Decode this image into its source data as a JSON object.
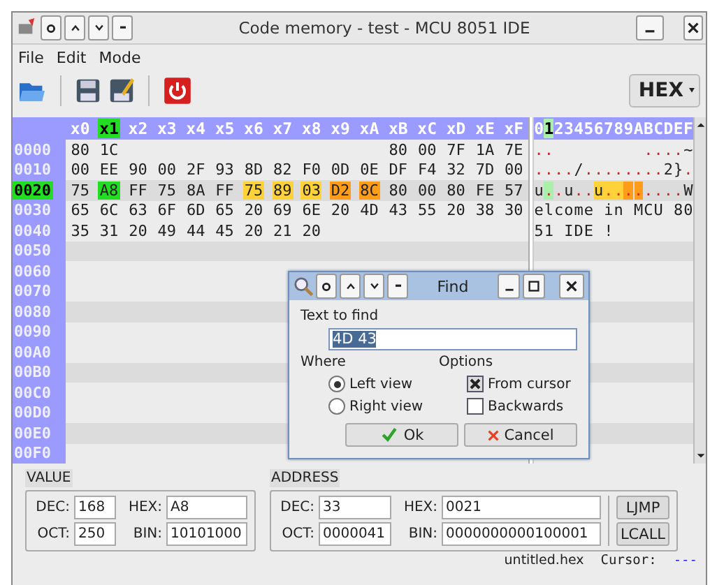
{
  "window": {
    "title": "Code memory - test - MCU 8051 IDE"
  },
  "menu": [
    {
      "label": "File"
    },
    {
      "label": "Edit"
    },
    {
      "label": "Mode"
    }
  ],
  "toolbar": {
    "mode": "HEX"
  },
  "hex": {
    "columns": [
      {
        "label": "x0",
        "selected": false
      },
      {
        "label": "x1",
        "selected": true
      },
      {
        "label": "x2",
        "selected": false
      },
      {
        "label": "x3",
        "selected": false
      },
      {
        "label": "x4",
        "selected": false
      },
      {
        "label": "x5",
        "selected": false
      },
      {
        "label": "x6",
        "selected": false
      },
      {
        "label": "x7",
        "selected": false
      },
      {
        "label": "x8",
        "selected": false
      },
      {
        "label": "x9",
        "selected": false
      },
      {
        "label": "xA",
        "selected": false
      },
      {
        "label": "xB",
        "selected": false
      },
      {
        "label": "xC",
        "selected": false
      },
      {
        "label": "xD",
        "selected": false
      },
      {
        "label": "xE",
        "selected": false
      },
      {
        "label": "xF",
        "selected": false
      }
    ],
    "ascii_columns": [
      {
        "label": "0",
        "selected": false
      },
      {
        "label": "1",
        "selected": true
      },
      {
        "label": "2",
        "selected": false
      },
      {
        "label": "3",
        "selected": false
      },
      {
        "label": "4",
        "selected": false
      },
      {
        "label": "5",
        "selected": false
      },
      {
        "label": "6",
        "selected": false
      },
      {
        "label": "7",
        "selected": false
      },
      {
        "label": "8",
        "selected": false
      },
      {
        "label": "9",
        "selected": false
      },
      {
        "label": "A",
        "selected": false
      },
      {
        "label": "B",
        "selected": false
      },
      {
        "label": "C",
        "selected": false
      },
      {
        "label": "D",
        "selected": false
      },
      {
        "label": "E",
        "selected": false
      },
      {
        "label": "F",
        "selected": false
      }
    ],
    "rows": [
      {
        "address": "0000",
        "selected": false,
        "cells": [
          {
            "kind": "byte",
            "text": "80"
          },
          {
            "kind": "byte",
            "text": "1C"
          },
          {
            "kind": "empty"
          },
          {
            "kind": "empty"
          },
          {
            "kind": "empty"
          },
          {
            "kind": "empty"
          },
          {
            "kind": "empty"
          },
          {
            "kind": "empty"
          },
          {
            "kind": "empty"
          },
          {
            "kind": "empty"
          },
          {
            "kind": "empty"
          },
          {
            "kind": "byte",
            "text": "80"
          },
          {
            "kind": "byte",
            "text": "00"
          },
          {
            "kind": "byte",
            "text": "7F"
          },
          {
            "kind": "byte",
            "text": "1A"
          },
          {
            "kind": "byte",
            "text": "7E"
          }
        ],
        "ascii": [
          {
            "kind": "char",
            "char": ".",
            "unprintable": true
          },
          {
            "kind": "char",
            "char": ".",
            "unprintable": true
          },
          {
            "kind": "empty"
          },
          {
            "kind": "empty"
          },
          {
            "kind": "empty"
          },
          {
            "kind": "empty"
          },
          {
            "kind": "empty"
          },
          {
            "kind": "empty"
          },
          {
            "kind": "empty"
          },
          {
            "kind": "empty"
          },
          {
            "kind": "empty"
          },
          {
            "kind": "char",
            "char": ".",
            "unprintable": true
          },
          {
            "kind": "char",
            "char": ".",
            "unprintable": true
          },
          {
            "kind": "char",
            "char": ".",
            "unprintable": true
          },
          {
            "kind": "char",
            "char": ".",
            "unprintable": true
          },
          {
            "kind": "char",
            "char": "~",
            "unprintable": false
          }
        ]
      },
      {
        "address": "0010",
        "selected": false,
        "cells": [
          {
            "kind": "byte",
            "text": "00"
          },
          {
            "kind": "byte",
            "text": "EE"
          },
          {
            "kind": "byte",
            "text": "90"
          },
          {
            "kind": "byte",
            "text": "00"
          },
          {
            "kind": "byte",
            "text": "2F"
          },
          {
            "kind": "byte",
            "text": "93"
          },
          {
            "kind": "byte",
            "text": "8D"
          },
          {
            "kind": "byte",
            "text": "82"
          },
          {
            "kind": "byte",
            "text": "F0"
          },
          {
            "kind": "byte",
            "text": "0D"
          },
          {
            "kind": "byte",
            "text": "0E"
          },
          {
            "kind": "byte",
            "text": "DF"
          },
          {
            "kind": "byte",
            "text": "F4"
          },
          {
            "kind": "byte",
            "text": "32"
          },
          {
            "kind": "byte",
            "text": "7D"
          },
          {
            "kind": "byte",
            "text": "00"
          }
        ],
        "ascii": [
          {
            "kind": "char",
            "char": ".",
            "unprintable": true
          },
          {
            "kind": "char",
            "char": ".",
            "unprintable": true
          },
          {
            "kind": "char",
            "char": ".",
            "unprintable": true
          },
          {
            "kind": "char",
            "char": ".",
            "unprintable": true
          },
          {
            "kind": "char",
            "char": "/",
            "unprintable": false
          },
          {
            "kind": "char",
            "char": ".",
            "unprintable": true
          },
          {
            "kind": "char",
            "char": ".",
            "unprintable": true
          },
          {
            "kind": "char",
            "char": ".",
            "unprintable": true
          },
          {
            "kind": "char",
            "char": ".",
            "unprintable": true
          },
          {
            "kind": "char",
            "char": ".",
            "unprintable": true
          },
          {
            "kind": "char",
            "char": ".",
            "unprintable": true
          },
          {
            "kind": "char",
            "char": ".",
            "unprintable": true
          },
          {
            "kind": "char",
            "char": ".",
            "unprintable": true
          },
          {
            "kind": "char",
            "char": "2",
            "unprintable": false
          },
          {
            "kind": "char",
            "char": "}",
            "unprintable": false
          },
          {
            "kind": "char",
            "char": ".",
            "unprintable": true
          }
        ]
      },
      {
        "address": "0020",
        "selected": true,
        "cells": [
          {
            "kind": "byte",
            "text": "75"
          },
          {
            "kind": "byte",
            "text": "A8",
            "color": "#22dd22"
          },
          {
            "kind": "byte",
            "text": "FF"
          },
          {
            "kind": "byte",
            "text": "75"
          },
          {
            "kind": "byte",
            "text": "8A"
          },
          {
            "kind": "byte",
            "text": "FF"
          },
          {
            "kind": "byte",
            "text": "75",
            "color": "#ffd23a"
          },
          {
            "kind": "byte",
            "text": "89",
            "color": "#ffd23a"
          },
          {
            "kind": "byte",
            "text": "03",
            "color": "#ffd23a"
          },
          {
            "kind": "byte",
            "text": "D2",
            "color": "#ff9c1a"
          },
          {
            "kind": "byte",
            "text": "8C",
            "color": "#ff9c1a"
          },
          {
            "kind": "byte",
            "text": "80"
          },
          {
            "kind": "byte",
            "text": "00"
          },
          {
            "kind": "byte",
            "text": "80"
          },
          {
            "kind": "byte",
            "text": "FE"
          },
          {
            "kind": "byte",
            "text": "57"
          }
        ],
        "ascii": [
          {
            "kind": "char",
            "char": "u",
            "unprintable": false
          },
          {
            "kind": "char",
            "char": ".",
            "unprintable": true,
            "color": "#aaf0aa"
          },
          {
            "kind": "char",
            "char": ".",
            "unprintable": true
          },
          {
            "kind": "char",
            "char": "u",
            "unprintable": false
          },
          {
            "kind": "char",
            "char": ".",
            "unprintable": true
          },
          {
            "kind": "char",
            "char": ".",
            "unprintable": true
          },
          {
            "kind": "char",
            "char": "u",
            "unprintable": false,
            "color": "#ffd23a"
          },
          {
            "kind": "char",
            "char": ".",
            "unprintable": true,
            "color": "#ffd23a"
          },
          {
            "kind": "char",
            "char": ".",
            "unprintable": true,
            "color": "#ffd23a"
          },
          {
            "kind": "char",
            "char": ".",
            "unprintable": true,
            "color": "#ff9c1a"
          },
          {
            "kind": "char",
            "char": ".",
            "unprintable": true,
            "color": "#ff9c1a"
          },
          {
            "kind": "char",
            "char": ".",
            "unprintable": true
          },
          {
            "kind": "char",
            "char": ".",
            "unprintable": true
          },
          {
            "kind": "char",
            "char": ".",
            "unprintable": true
          },
          {
            "kind": "char",
            "char": ".",
            "unprintable": true
          },
          {
            "kind": "char",
            "char": "W",
            "unprintable": false
          }
        ]
      },
      {
        "address": "0030",
        "selected": false,
        "cells": [
          {
            "kind": "byte",
            "text": "65"
          },
          {
            "kind": "byte",
            "text": "6C"
          },
          {
            "kind": "byte",
            "text": "63"
          },
          {
            "kind": "byte",
            "text": "6F"
          },
          {
            "kind": "byte",
            "text": "6D"
          },
          {
            "kind": "byte",
            "text": "65"
          },
          {
            "kind": "byte",
            "text": "20"
          },
          {
            "kind": "byte",
            "text": "69"
          },
          {
            "kind": "byte",
            "text": "6E"
          },
          {
            "kind": "byte",
            "text": "20"
          },
          {
            "kind": "byte",
            "text": "4D"
          },
          {
            "kind": "byte",
            "text": "43"
          },
          {
            "kind": "byte",
            "text": "55"
          },
          {
            "kind": "byte",
            "text": "20"
          },
          {
            "kind": "byte",
            "text": "38"
          },
          {
            "kind": "byte",
            "text": "30"
          }
        ],
        "ascii": [
          {
            "kind": "char",
            "char": "e",
            "unprintable": false
          },
          {
            "kind": "char",
            "char": "l",
            "unprintable": false
          },
          {
            "kind": "char",
            "char": "c",
            "unprintable": false
          },
          {
            "kind": "char",
            "char": "o",
            "unprintable": false
          },
          {
            "kind": "char",
            "char": "m",
            "unprintable": false
          },
          {
            "kind": "char",
            "char": "e",
            "unprintable": false
          },
          {
            "kind": "empty"
          },
          {
            "kind": "char",
            "char": "i",
            "unprintable": false
          },
          {
            "kind": "char",
            "char": "n",
            "unprintable": false
          },
          {
            "kind": "empty"
          },
          {
            "kind": "char",
            "char": "M",
            "unprintable": false
          },
          {
            "kind": "char",
            "char": "C",
            "unprintable": false
          },
          {
            "kind": "char",
            "char": "U",
            "unprintable": false
          },
          {
            "kind": "empty"
          },
          {
            "kind": "char",
            "char": "8",
            "unprintable": false
          },
          {
            "kind": "char",
            "char": "0",
            "unprintable": false
          }
        ]
      },
      {
        "address": "0040",
        "selected": false,
        "cells": [
          {
            "kind": "byte",
            "text": "35"
          },
          {
            "kind": "byte",
            "text": "31"
          },
          {
            "kind": "byte",
            "text": "20"
          },
          {
            "kind": "byte",
            "text": "49"
          },
          {
            "kind": "byte",
            "text": "44"
          },
          {
            "kind": "byte",
            "text": "45"
          },
          {
            "kind": "byte",
            "text": "20"
          },
          {
            "kind": "byte",
            "text": "21"
          },
          {
            "kind": "byte",
            "text": "20"
          }
        ],
        "ascii": [
          {
            "kind": "char",
            "char": "5",
            "unprintable": false
          },
          {
            "kind": "char",
            "char": "1",
            "unprintable": false
          },
          {
            "kind": "empty"
          },
          {
            "kind": "char",
            "char": "I",
            "unprintable": false
          },
          {
            "kind": "char",
            "char": "D",
            "unprintable": false
          },
          {
            "kind": "char",
            "char": "E",
            "unprintable": false
          },
          {
            "kind": "empty"
          },
          {
            "kind": "char",
            "char": "!",
            "unprintable": false
          }
        ]
      },
      {
        "address": "0050",
        "selected": false
      },
      {
        "address": "0060",
        "selected": false
      },
      {
        "address": "0070",
        "selected": false
      },
      {
        "address": "0080",
        "selected": false
      },
      {
        "address": "0090",
        "selected": false
      },
      {
        "address": "00A0",
        "selected": false
      },
      {
        "address": "00B0",
        "selected": false
      },
      {
        "address": "00C0",
        "selected": false
      },
      {
        "address": "00D0",
        "selected": false
      },
      {
        "address": "00E0",
        "selected": false
      },
      {
        "address": "00F0",
        "selected": false
      }
    ]
  },
  "find_dialog": {
    "title": "Find",
    "label": "Text to find",
    "value": "4D 43",
    "where_label": "Where",
    "where": [
      {
        "label": "Left view",
        "selected": true
      },
      {
        "label": "Right view",
        "selected": false
      }
    ],
    "options_label": "Options",
    "options": [
      {
        "label": "From cursor",
        "checked": true
      },
      {
        "label": "Backwards",
        "checked": false
      }
    ],
    "buttons": [
      {
        "label": "Ok",
        "kind": "ok"
      },
      {
        "label": "Cancel",
        "kind": "cancel"
      }
    ]
  },
  "value": {
    "title": "VALUE",
    "fields": [
      {
        "label": "DEC:",
        "value": "168"
      },
      {
        "label": "HEX:",
        "value": "A8"
      },
      {
        "label": "OCT:",
        "value": "250"
      },
      {
        "label": "BIN:",
        "value": "10101000"
      }
    ]
  },
  "address": {
    "title": "ADDRESS",
    "fields": [
      {
        "label": "DEC:",
        "value": "33"
      },
      {
        "label": "HEX:",
        "value": "0021"
      },
      {
        "label": "OCT:",
        "value": "0000041"
      },
      {
        "label": "BIN:",
        "value": "0000000000100001"
      }
    ],
    "buttons": [
      "LJMP",
      "LCALL"
    ]
  },
  "status_bar": {
    "file": "untitled.hex",
    "cursor_label": "Cursor:",
    "cursor": "---"
  }
}
